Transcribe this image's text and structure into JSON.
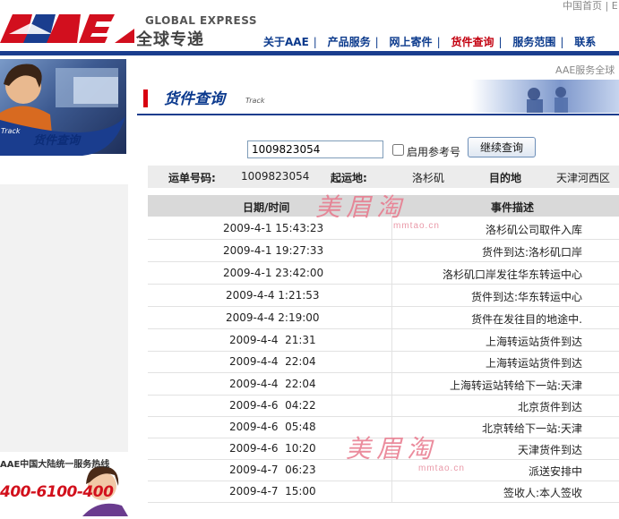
{
  "util_links": "中国首页 | E",
  "logo": {
    "brand": "AAE",
    "sub_en": "GLOBAL EXPRESS",
    "sub_cn": "全球专递"
  },
  "nav": [
    {
      "label": "关于AAE",
      "active": false
    },
    {
      "label": "产品服务",
      "active": false
    },
    {
      "label": "网上寄件",
      "active": false
    },
    {
      "label": "货件查询",
      "active": true
    },
    {
      "label": "服务范围",
      "active": false
    },
    {
      "label": "联系",
      "active": false
    }
  ],
  "nav_separator": "|",
  "hero": {
    "title": "货件查询",
    "track": "Track"
  },
  "hotline": {
    "text": "AAE中国大陆统一服务热线",
    "number": "400-6100-400"
  },
  "header": {
    "aae_service": "AAE服务全球",
    "section_title": "货件查询",
    "section_en": "Track"
  },
  "search": {
    "value": "1009823054",
    "checkbox_label": "启用参考号",
    "button": "继续查询"
  },
  "summary": {
    "waybill_label": "运单号码:",
    "waybill_value": "1009823054",
    "origin_label": "起运地:",
    "origin_value": "洛杉矶",
    "dest_label": "目的地",
    "dest_value": "天津河西区"
  },
  "table": {
    "headers": [
      "日期/时间",
      "事件描述"
    ],
    "rows": [
      [
        "2009-4-1 15:43:23",
        "洛杉矶公司取件入库"
      ],
      [
        "2009-4-1 19:27:33",
        "货件到达:洛杉矶口岸"
      ],
      [
        "2009-4-1 23:42:00",
        "洛杉矶口岸发往华东转运中心"
      ],
      [
        "2009-4-4 1:21:53",
        "货件到达:华东转运中心"
      ],
      [
        "2009-4-4 2:19:00",
        "货件在发往目的地途中."
      ],
      [
        "2009-4-4  21:31",
        "上海转运站货件到达"
      ],
      [
        "2009-4-4  22:04",
        "上海转运站货件到达"
      ],
      [
        "2009-4-4  22:04",
        "上海转运站转给下一站:天津"
      ],
      [
        "2009-4-6  04:22",
        "北京货件到达"
      ],
      [
        "2009-4-6  05:48",
        "北京转给下一站:天津"
      ],
      [
        "2009-4-6  10:20",
        "天津货件到达"
      ],
      [
        "2009-4-7  06:23",
        "派送安排中"
      ],
      [
        "2009-4-7  15:00",
        "签收人:本人签收"
      ]
    ]
  },
  "watermark": {
    "text": "美眉淘",
    "url": "mmtao.cn"
  },
  "colors": {
    "brand_blue": "#0c3a8e",
    "brand_red": "#d80010",
    "nav_active": "#c3000f"
  }
}
